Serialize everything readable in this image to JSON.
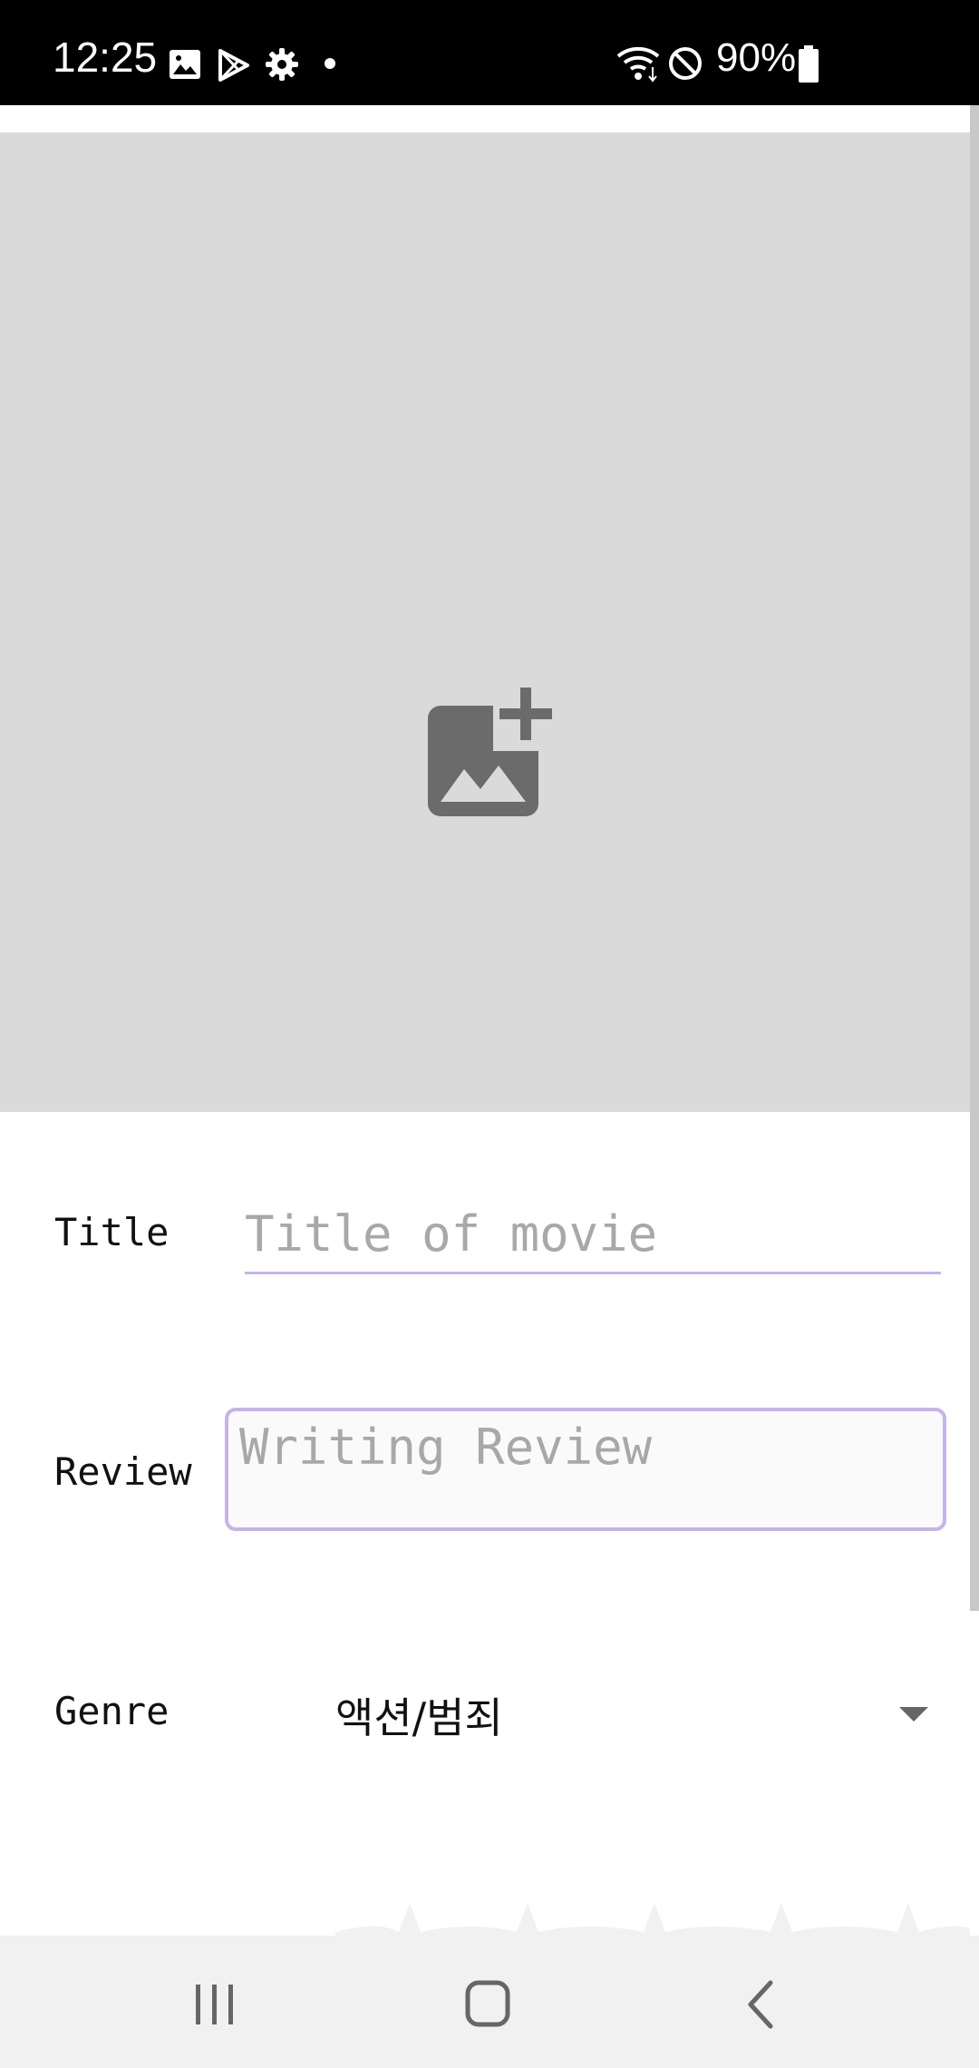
{
  "status_bar": {
    "time": "12:25",
    "battery": "90%",
    "icons": [
      "image-icon",
      "play-store-icon",
      "settings-icon",
      "dot-icon",
      "wifi-icon",
      "do-not-disturb-icon",
      "battery-icon"
    ]
  },
  "image_picker": {
    "icon": "add-photo-icon"
  },
  "form": {
    "title_label": "Title",
    "title_placeholder": "Title of movie",
    "review_label": "Review",
    "review_placeholder": "Writing Review",
    "genre_label": "Genre",
    "genre_value": "액션/범죄"
  },
  "colors": {
    "accent": "#c5b3ec",
    "placeholder_bg": "#dadada",
    "icon": "#6b6b6b"
  },
  "nav_bar": {
    "buttons": [
      "recent-apps-icon",
      "home-icon",
      "back-icon"
    ]
  }
}
